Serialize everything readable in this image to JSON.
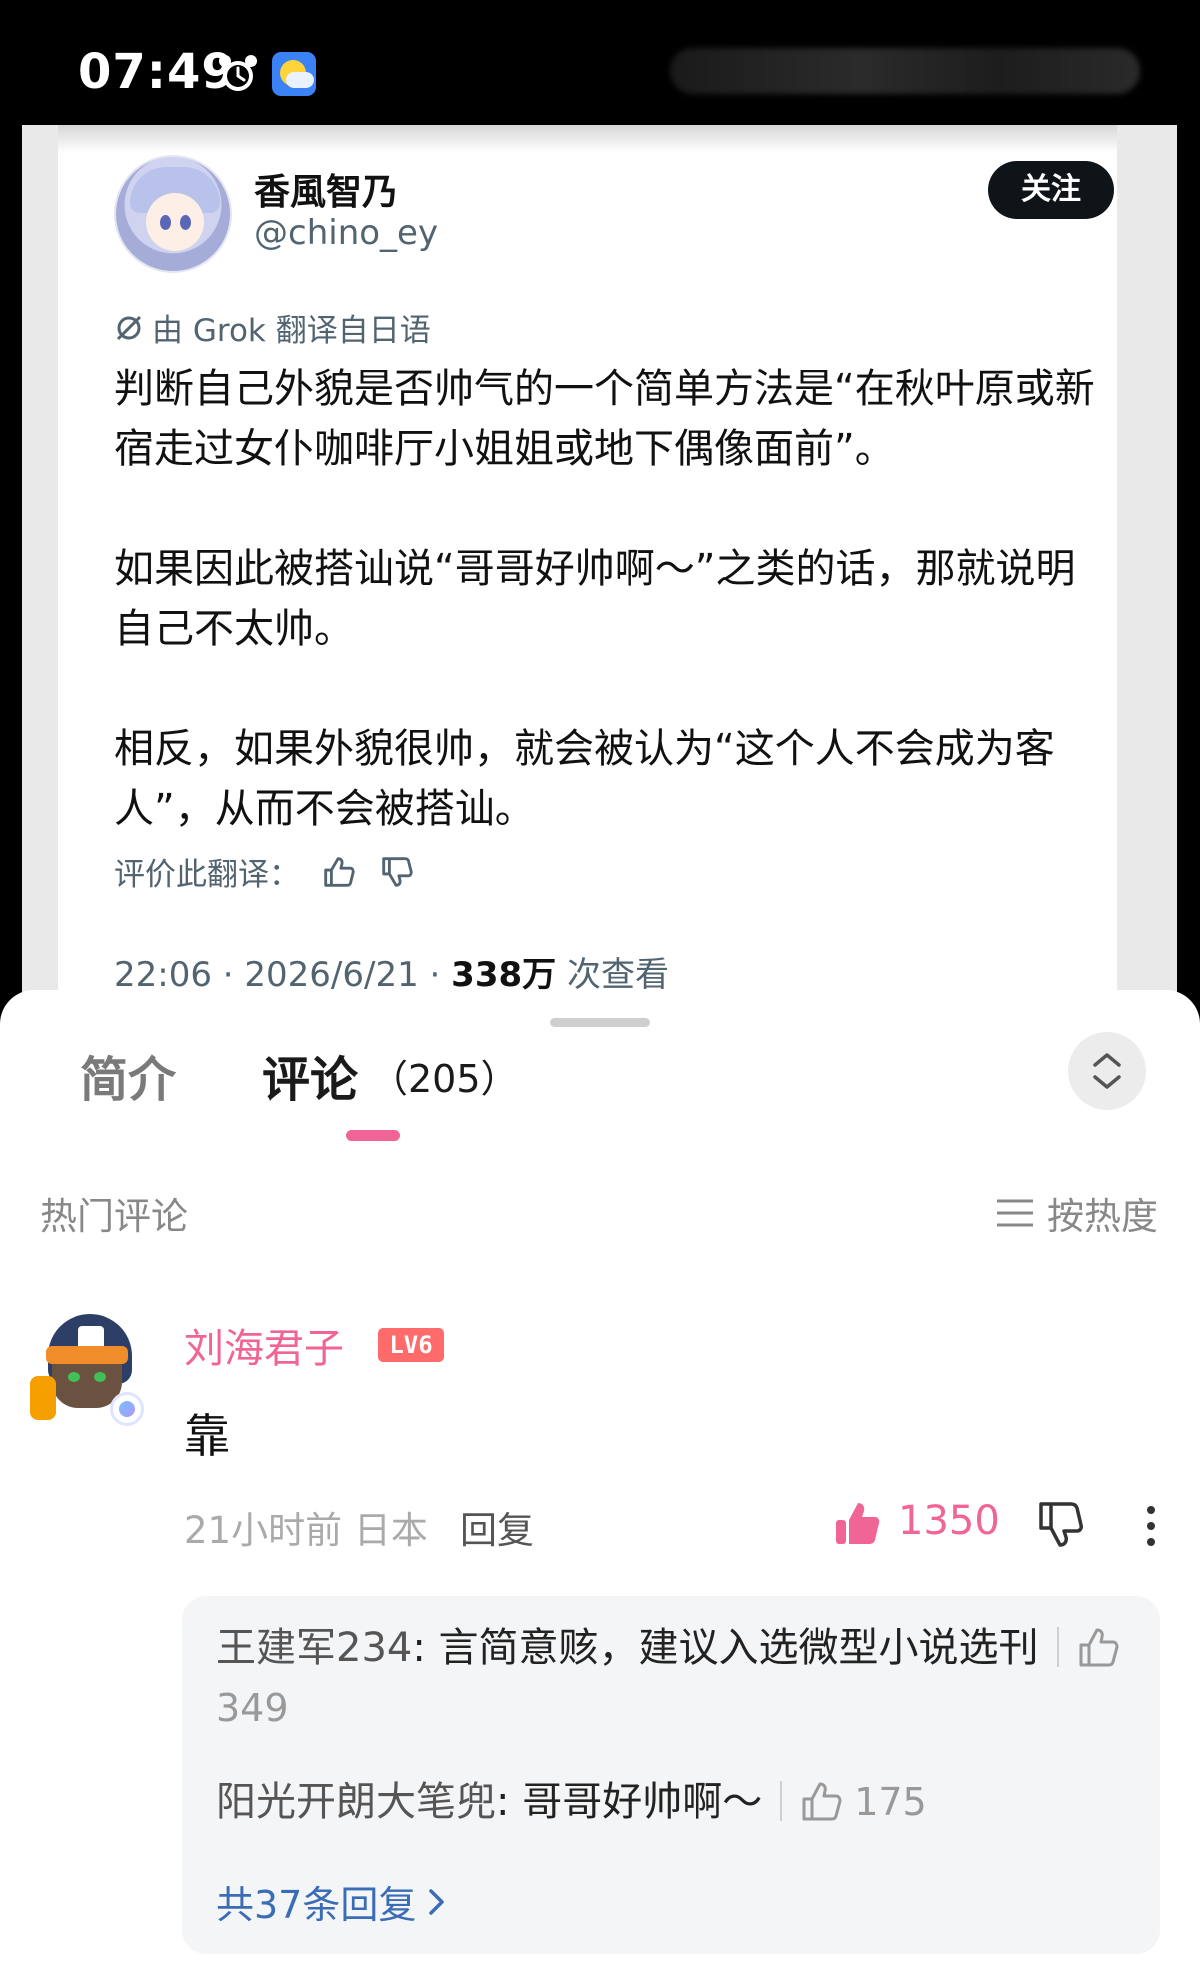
{
  "status_bar": {
    "time": "07:49",
    "icons": [
      "alarm-icon",
      "weather-icon"
    ]
  },
  "post": {
    "author_name": "香風智乃",
    "author_handle": "@chino_ey",
    "follow_label": "关注",
    "translate_note": "由 Grok 翻译自日语",
    "paragraphs": [
      "判断自己外貌是否帅气的一个简单方法是“在秋叶原或新宿走过女仆咖啡厅小姐姐或地下偶像面前”。",
      "如果因此被搭讪说“哥哥好帅啊～”之类的话，那就说明自己不太帅。",
      "相反，如果外貌很帅，就会被认为“这个人不会成为客人”，从而不会被搭讪。"
    ],
    "rate_label": "评价此翻译：",
    "time": "22:06 · 2026/6/21 · ",
    "views": "338万",
    "views_suffix": " 次查看"
  },
  "sheet": {
    "tab_intro": "简介",
    "tab_comments": "评论",
    "comment_count": "（205）",
    "hot_label": "热门评论",
    "sort_label": "按热度"
  },
  "comment": {
    "user": "刘海君子",
    "level": "LV6",
    "text": "靠",
    "time_location": "21小时前 日本",
    "reply_label": "回复",
    "likes": "1350",
    "replies": [
      {
        "name": "王建军234",
        "text": ": 言简意赅，建议入选微型小说选刊",
        "likes": "349"
      },
      {
        "name": "阳光开朗大笔兜",
        "text": ": 哥哥好帅啊～",
        "likes": "175"
      }
    ],
    "more_replies": "共37条回复"
  },
  "colors": {
    "accent_pink": "#f06595",
    "link_blue": "#3a6db5",
    "follow_bg": "#0f1419"
  }
}
